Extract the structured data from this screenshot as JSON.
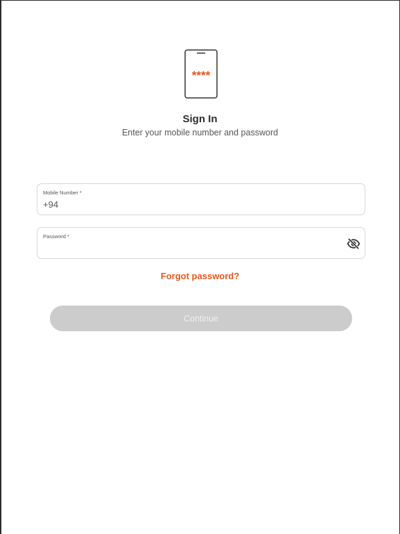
{
  "header": {
    "title": "Sign In",
    "subtitle": "Enter your mobile number and password",
    "icon": "phone-password-icon",
    "icon_text": "****"
  },
  "form": {
    "mobile": {
      "label": "Mobile Number *",
      "value": "+94"
    },
    "password": {
      "label": "Password *",
      "value": "",
      "toggle_icon": "eye-off-icon"
    },
    "forgot_link": "Forgot password?",
    "continue_label": "Continue",
    "continue_disabled": true
  },
  "colors": {
    "accent": "#e8561a",
    "button_disabled_bg": "#cccccc",
    "button_disabled_text": "#eeeeee",
    "field_border": "#d6d6d6",
    "title_text": "#2d2d2d",
    "muted_text": "#555555"
  }
}
